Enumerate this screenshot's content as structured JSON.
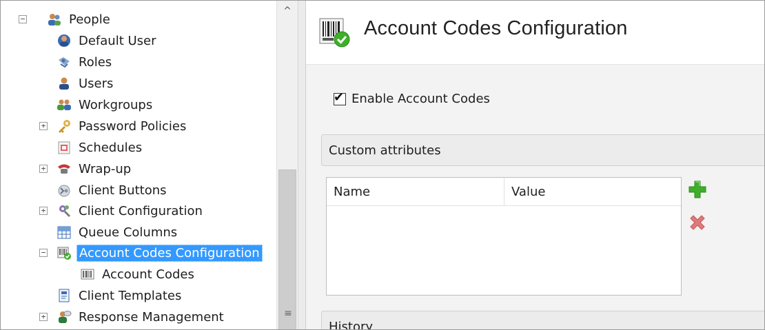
{
  "tree": {
    "items": [
      {
        "label": "People",
        "icon": "people-icon",
        "expander": "−",
        "level": 0
      },
      {
        "label": "Default User",
        "icon": "default-user-icon",
        "expander": "",
        "level": 1
      },
      {
        "label": "Roles",
        "icon": "roles-icon",
        "expander": "",
        "level": 1
      },
      {
        "label": "Users",
        "icon": "user-icon",
        "expander": "",
        "level": 1
      },
      {
        "label": "Workgroups",
        "icon": "workgroups-icon",
        "expander": "",
        "level": 1
      },
      {
        "label": "Password Policies",
        "icon": "key-icon",
        "expander": "+",
        "level": 1
      },
      {
        "label": "Schedules",
        "icon": "schedule-icon",
        "expander": "",
        "level": 1
      },
      {
        "label": "Wrap-up",
        "icon": "wrap-up-icon",
        "expander": "+",
        "level": 1
      },
      {
        "label": "Client Buttons",
        "icon": "client-buttons-icon",
        "expander": "",
        "level": 1
      },
      {
        "label": "Client Configuration",
        "icon": "client-configuration-icon",
        "expander": "+",
        "level": 1
      },
      {
        "label": "Queue Columns",
        "icon": "queue-columns-icon",
        "expander": "",
        "level": 1
      },
      {
        "label": "Account Codes Configuration",
        "icon": "account-codes-configuration-icon",
        "expander": "−",
        "level": 1,
        "selected": true
      },
      {
        "label": "Account Codes",
        "icon": "barcode-icon",
        "expander": "",
        "level": 2
      },
      {
        "label": "Client Templates",
        "icon": "client-templates-icon",
        "expander": "",
        "level": 1
      },
      {
        "label": "Response Management",
        "icon": "response-management-icon",
        "expander": "+",
        "level": 1
      }
    ],
    "selection_color": "#3399ff"
  },
  "scrollbar": {
    "up_arrow": "^",
    "grip": "≡"
  },
  "page": {
    "title": "Account Codes Configuration",
    "icon": "barcode-check-icon"
  },
  "enable_checkbox": {
    "label": "Enable Account Codes",
    "checked": true,
    "mark": "✔"
  },
  "custom_attributes": {
    "header": "Custom attributes",
    "columns": [
      "Name",
      "Value"
    ],
    "rows": [],
    "add_icon": "add-icon",
    "remove_icon": "remove-icon",
    "add_color": "#3fae2a",
    "remove_color": "#e06a6a"
  },
  "history": {
    "header": "History"
  }
}
